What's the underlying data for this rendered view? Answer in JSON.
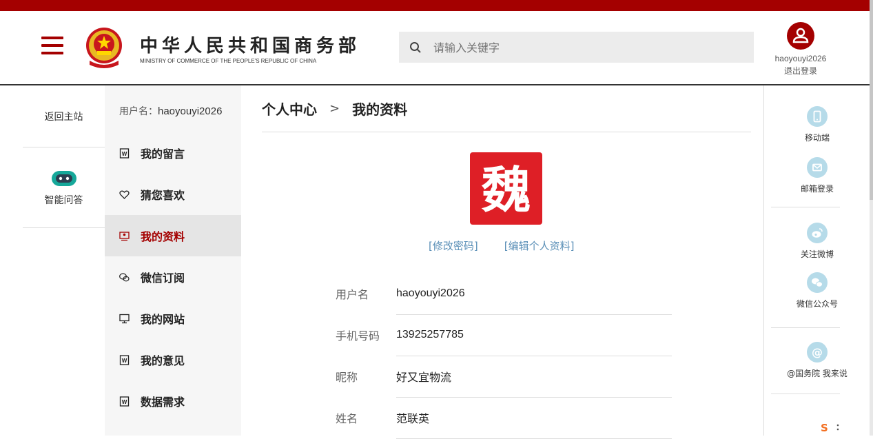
{
  "header": {
    "ministry_cn": "中华人民共和国商务部",
    "ministry_en": "MINISTRY OF COMMERCE OF THE PEOPLE'S REPUBLIC OF CHINA",
    "search_placeholder": "请输入关键字",
    "user_name": "haoyouyi2026",
    "logout": "退出登录",
    "accent_color": "#a40000"
  },
  "left": {
    "back_home": "返回主站",
    "ai_qa": "智能问答"
  },
  "sidebar": {
    "username_label": "用户名：",
    "username": "haoyouyi2026",
    "items": [
      {
        "label": "我的留言",
        "icon": "document-icon"
      },
      {
        "label": "猜您喜欢",
        "icon": "heart-icon"
      },
      {
        "label": "我的资料",
        "icon": "profile-icon",
        "active": true
      },
      {
        "label": "微信订阅",
        "icon": "wechat-icon"
      },
      {
        "label": "我的网站",
        "icon": "monitor-icon"
      },
      {
        "label": "我的意见",
        "icon": "document-icon"
      },
      {
        "label": "数据需求",
        "icon": "document-icon"
      }
    ]
  },
  "main": {
    "breadcrumb_root": "个人中心",
    "breadcrumb_sep": ">",
    "breadcrumb_current": "我的资料",
    "avatar_char": "魏",
    "change_password": "[修改密码]",
    "edit_profile": "[编辑个人资料]",
    "fields": [
      {
        "label": "用户名",
        "value": "haoyouyi2026"
      },
      {
        "label": "手机号码",
        "value": "13925257785"
      },
      {
        "label": "昵称",
        "value": "好又宜物流"
      },
      {
        "label": "姓名",
        "value": "范联英"
      }
    ]
  },
  "right": {
    "items": [
      {
        "label": "移动端",
        "icon": "mobile-icon"
      },
      {
        "label": "邮箱登录",
        "icon": "mail-icon"
      },
      {
        "label": "关注微博",
        "icon": "weibo-icon"
      },
      {
        "label": "微信公众号",
        "icon": "wechat-icon"
      },
      {
        "label": "@国务院 我来说",
        "icon": "at-icon"
      }
    ]
  }
}
